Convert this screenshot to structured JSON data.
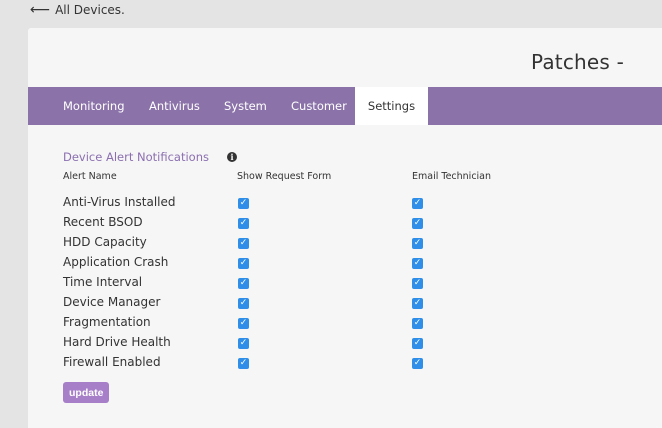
{
  "nav": {
    "back_label": "All Devices."
  },
  "page": {
    "title": "Patches -"
  },
  "tabs": [
    {
      "label": "Monitoring"
    },
    {
      "label": "Antivirus"
    },
    {
      "label": "System"
    },
    {
      "label": "Customer"
    },
    {
      "label": "Settings",
      "active": true
    }
  ],
  "alerts": {
    "section_title": "Device Alert Notifications",
    "columns": {
      "name": "Alert Name",
      "request_form": "Show Request Form",
      "email": "Email Technician"
    },
    "rows": [
      {
        "name": "Anti-Virus Installed",
        "request_form": true,
        "email": true
      },
      {
        "name": "Recent BSOD",
        "request_form": true,
        "email": true
      },
      {
        "name": "HDD Capacity",
        "request_form": true,
        "email": true
      },
      {
        "name": "Application Crash",
        "request_form": true,
        "email": true
      },
      {
        "name": "Time Interval",
        "request_form": true,
        "email": true
      },
      {
        "name": "Device Manager",
        "request_form": true,
        "email": true
      },
      {
        "name": "Fragmentation",
        "request_form": true,
        "email": true
      },
      {
        "name": "Hard Drive Health",
        "request_form": true,
        "email": true
      },
      {
        "name": "Firewall Enabled",
        "request_form": true,
        "email": true
      }
    ],
    "update_label": "update"
  },
  "colors": {
    "tab_bar": "#8b73a9",
    "section_title": "#8b6fb0",
    "checkbox": "#2f8fe8",
    "update_button": "#a77fc9"
  }
}
